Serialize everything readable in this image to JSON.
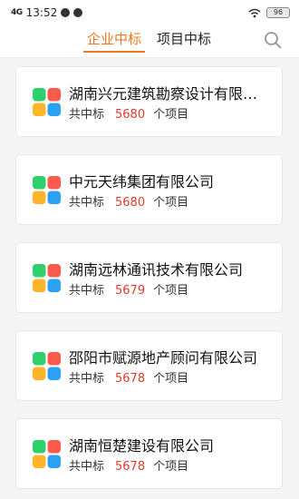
{
  "status_bar": {
    "signal": "4G",
    "time": "13:52",
    "battery": "96"
  },
  "tabs": [
    {
      "label": "企业中标",
      "active": true
    },
    {
      "label": "项目中标",
      "active": false
    }
  ],
  "colors": {
    "accent": "#f07a1e",
    "count": "#e43a2c",
    "logo": [
      "#ff5a4e",
      "#ffb52b",
      "#2fcf6b",
      "#2aa1f5"
    ]
  },
  "items": [
    {
      "name": "湖南兴元建筑勘察设计有限公司",
      "prefix": "共中标",
      "count": "5680",
      "suffix": "个项目"
    },
    {
      "name": "中元天纬集团有限公司",
      "prefix": "共中标",
      "count": "5680",
      "suffix": "个项目"
    },
    {
      "name": "湖南远林通讯技术有限公司",
      "prefix": "共中标",
      "count": "5679",
      "suffix": "个项目"
    },
    {
      "name": "邵阳市赋源地产顾问有限公司",
      "prefix": "共中标",
      "count": "5678",
      "suffix": "个项目"
    },
    {
      "name": "湖南恒楚建设有限公司",
      "prefix": "共中标",
      "count": "5678",
      "suffix": "个项目"
    }
  ]
}
